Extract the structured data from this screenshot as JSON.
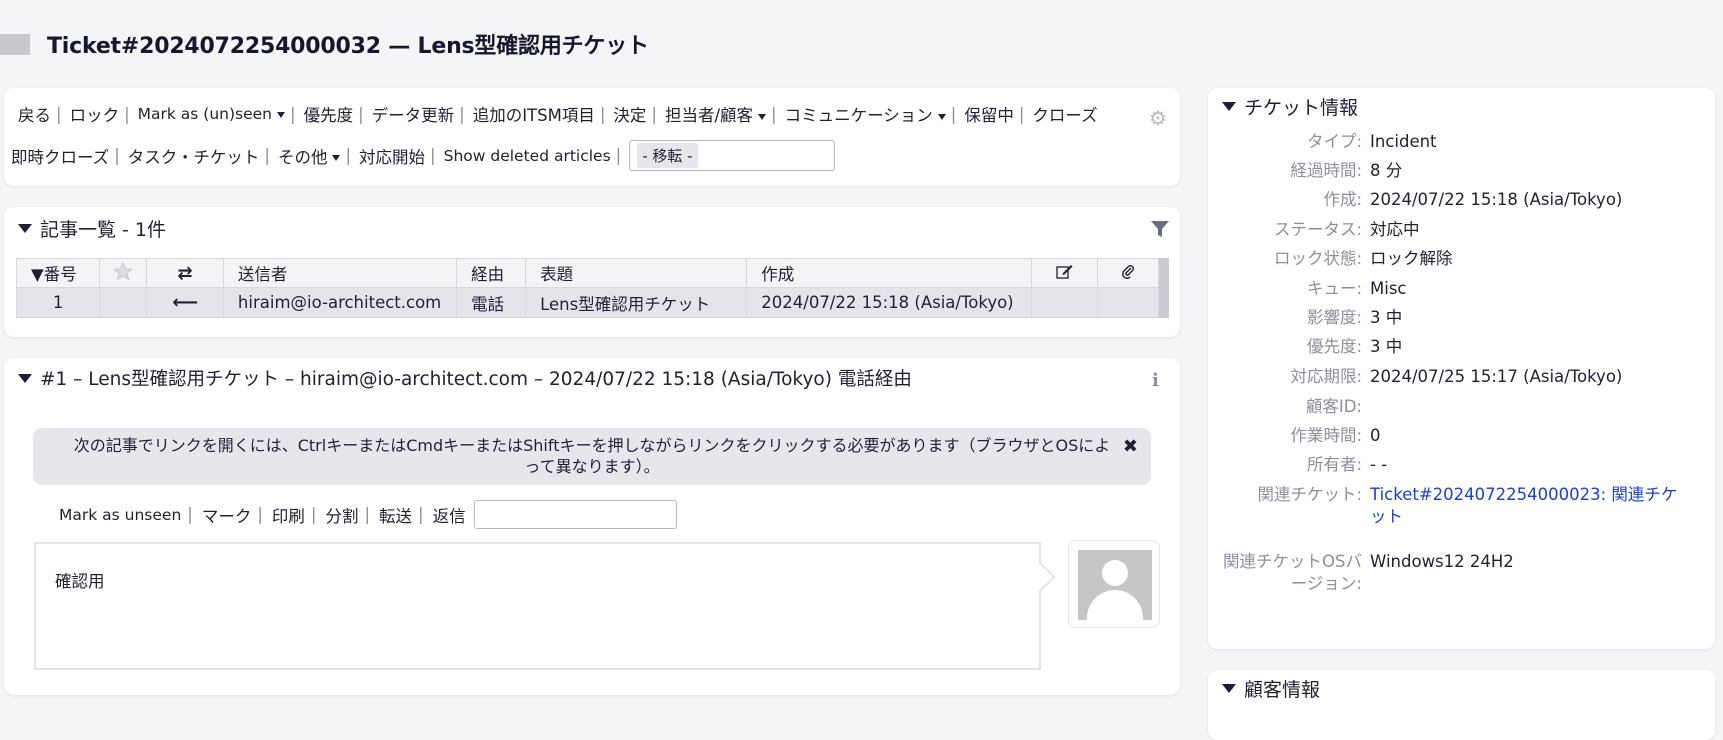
{
  "header": {
    "title": "Ticket#2024072254000032 — Lens型確認用チケット"
  },
  "toolbar": {
    "row1": [
      {
        "label": "戻る",
        "caret": false
      },
      {
        "label": "ロック",
        "caret": false
      },
      {
        "label": "Mark as (un)seen",
        "caret": true
      },
      {
        "label": "優先度",
        "caret": false
      },
      {
        "label": "データ更新",
        "caret": false
      },
      {
        "label": "追加のITSM項目",
        "caret": false
      },
      {
        "label": "決定",
        "caret": false
      },
      {
        "label": "担当者/顧客",
        "caret": true
      },
      {
        "label": "コミュニケーション",
        "caret": true
      },
      {
        "label": "保留中",
        "caret": false
      },
      {
        "label": "クローズ",
        "caret": false
      }
    ],
    "row2": [
      {
        "label": "即時クローズ",
        "caret": false
      },
      {
        "label": "タスク・チケット",
        "caret": false
      },
      {
        "label": "その他",
        "caret": true
      },
      {
        "label": "対応開始",
        "caret": false
      },
      {
        "label": "Show deleted articles",
        "caret": false
      }
    ],
    "transfer_select": "- 移転 -"
  },
  "articles": {
    "title": "記事一覧 - 1件",
    "columns": {
      "number": "▼番号",
      "sender": "送信者",
      "via": "経由",
      "subject": "表題",
      "created": "作成"
    },
    "rows": [
      {
        "number": "1",
        "sender": "hiraim@io-architect.com",
        "via": "電話",
        "subject": "Lens型確認用チケット",
        "created": "2024/07/22 15:18 (Asia/Tokyo)"
      }
    ]
  },
  "article": {
    "title": "#1 – Lens型確認用チケット – hiraim@io-architect.com – 2024/07/22 15:18 (Asia/Tokyo) 電話経由",
    "notice": "次の記事でリンクを開くには、CtrlキーまたはCmdキーまたはShiftキーを押しながらリンクをクリックする必要があります（ブラウザとOSによって異なります）。",
    "actions": [
      "Mark as unseen",
      "マーク",
      "印刷",
      "分割",
      "転送",
      "返信"
    ],
    "body": "確認用"
  },
  "ticket_info": {
    "title": "チケット情報",
    "fields": [
      {
        "key": "タイプ:",
        "value": "Incident"
      },
      {
        "key": "経過時間:",
        "value": "8 分"
      },
      {
        "key": "作成:",
        "value": "2024/07/22 15:18 (Asia/Tokyo)"
      },
      {
        "key": "ステータス:",
        "value": "対応中"
      },
      {
        "key": "ロック状態:",
        "value": "ロック解除"
      },
      {
        "key": "キュー:",
        "value": "Misc"
      },
      {
        "key": "影響度:",
        "value": "3 中"
      },
      {
        "key": "優先度:",
        "value": "3 中"
      },
      {
        "key": "対応期限:",
        "value": "2024/07/25 15:17 (Asia/Tokyo)"
      },
      {
        "key": "顧客ID:",
        "value": ""
      },
      {
        "key": "作業時間:",
        "value": "0"
      },
      {
        "key": "所有者:",
        "value": "- -"
      }
    ],
    "linked_ticket": {
      "key": "関連チケット:",
      "value": "Ticket#2024072254000023: 関連チケット"
    },
    "os_version": {
      "key": "関連チケットOSバージョン:",
      "value": "Windows12 24H2"
    }
  },
  "customer_info": {
    "title": "顧客情報"
  }
}
